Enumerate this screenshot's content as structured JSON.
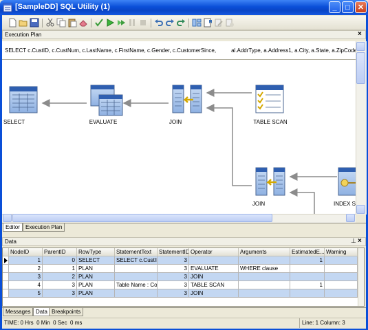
{
  "window": {
    "title": "[SampleDD] SQL Utility (1)",
    "minimize": "_",
    "maximize": "□",
    "close": "✕"
  },
  "toolbar": {
    "icons": [
      "new-file-icon",
      "open-folder-icon",
      "save-icon",
      "cut-icon",
      "copy-icon",
      "paste-icon",
      "eraser-icon",
      "check-icon",
      "run-icon",
      "run-step-icon",
      "pause-icon",
      "stop-icon",
      "undo-icon",
      "redo-icon",
      "redo-all-icon",
      "layout-icon",
      "bookmark-icon",
      "edit-icon",
      "tools-icon"
    ]
  },
  "execution_plan": {
    "header": "Execution Plan",
    "close": "×",
    "sql_left": "SELECT c.CustID, c.CustNum, c.LastName, c.FirstName, c.Gender, c.CustomerSince,",
    "sql_right": "al.AddrType, a.Address1, a.City, a.State, a.ZipCode",
    "nodes": {
      "select": "SELECT",
      "evaluate": "EVALUATE",
      "join1": "JOIN",
      "table_scan": "TABLE SCAN",
      "join2": "JOIN",
      "index_scan": "INDEX S"
    }
  },
  "tabs_top": [
    "Editor",
    "Execution Plan"
  ],
  "data_panel": {
    "header": "Data",
    "pin": "⊥",
    "close": "×",
    "columns": [
      "NodeID",
      "ParentID",
      "RowType",
      "StatementText",
      "StatementID",
      "Operator",
      "Arguments",
      "EstimatedE...",
      "Warning"
    ],
    "rows": [
      {
        "node": "1",
        "parent": "0",
        "type": "SELECT",
        "text": "SELECT c.CustID",
        "sid": "3",
        "op": "",
        "args": "",
        "est": "1",
        "warn": ""
      },
      {
        "node": "2",
        "parent": "1",
        "type": "PLAN",
        "text": "",
        "sid": "3",
        "op": "EVALUATE",
        "args": "WHERE clause",
        "est": "",
        "warn": ""
      },
      {
        "node": "3",
        "parent": "2",
        "type": "PLAN",
        "text": "",
        "sid": "3",
        "op": "JOIN",
        "args": "",
        "est": "",
        "warn": ""
      },
      {
        "node": "4",
        "parent": "3",
        "type": "PLAN",
        "text": "Table Name : Co",
        "sid": "3",
        "op": "TABLE SCAN",
        "args": "",
        "est": "1",
        "warn": ""
      },
      {
        "node": "5",
        "parent": "3",
        "type": "PLAN",
        "text": "",
        "sid": "3",
        "op": "JOIN",
        "args": "",
        "est": "",
        "warn": ""
      }
    ]
  },
  "tabs_bottom": [
    "Messages",
    "Data",
    "Breakpoints"
  ],
  "status": {
    "time": "TIME: 0 Hrs  0 Min  0 Sec  0 ms",
    "position": "Line: 1  Column: 3"
  }
}
